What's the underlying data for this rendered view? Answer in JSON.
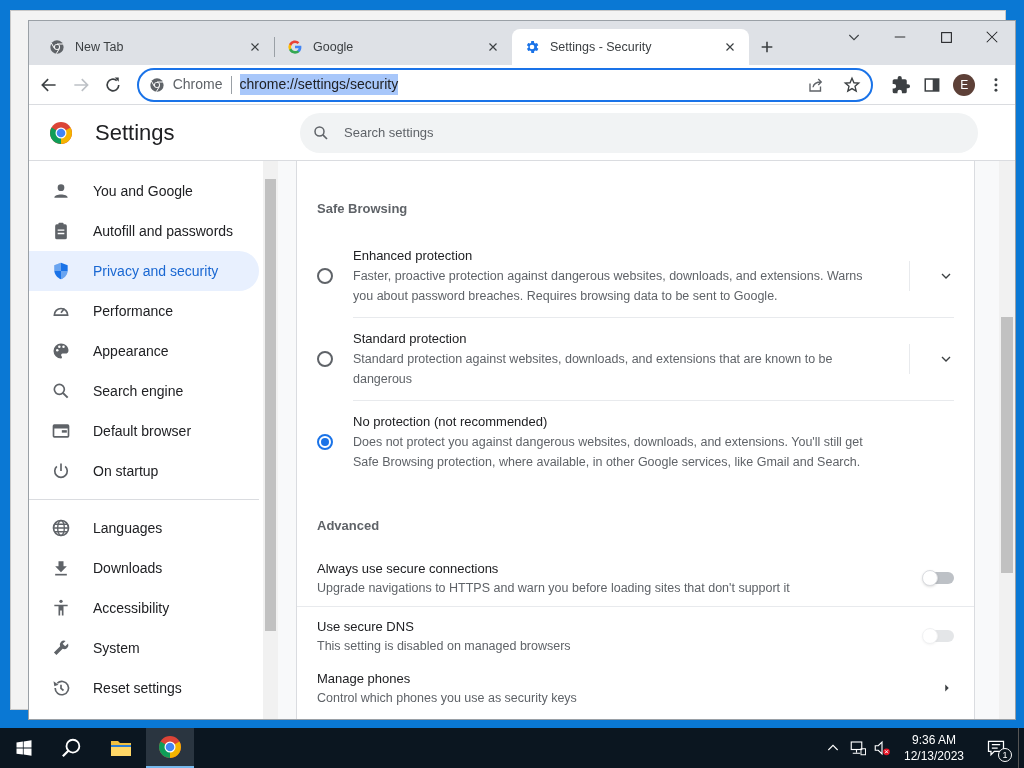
{
  "tabs": [
    {
      "title": "New Tab",
      "selected": false
    },
    {
      "title": "Google",
      "selected": false
    },
    {
      "title": "Settings - Security",
      "selected": true
    }
  ],
  "address_bar": {
    "site_label": "Chrome",
    "url": "chrome://settings/security",
    "url_selected": true
  },
  "profile": {
    "initial": "E"
  },
  "header": {
    "title": "Settings",
    "search": {
      "placeholder": "Search settings"
    }
  },
  "sidebar": {
    "groups": [
      [
        {
          "label": "You and Google",
          "selected": false
        },
        {
          "label": "Autofill and passwords",
          "selected": false
        },
        {
          "label": "Privacy and security",
          "selected": true
        },
        {
          "label": "Performance",
          "selected": false
        },
        {
          "label": "Appearance",
          "selected": false
        },
        {
          "label": "Search engine",
          "selected": false
        },
        {
          "label": "Default browser",
          "selected": false
        },
        {
          "label": "On startup",
          "selected": false
        }
      ],
      [
        {
          "label": "Languages",
          "selected": false
        },
        {
          "label": "Downloads",
          "selected": false
        },
        {
          "label": "Accessibility",
          "selected": false
        },
        {
          "label": "System",
          "selected": false
        },
        {
          "label": "Reset settings",
          "selected": false
        }
      ]
    ]
  },
  "safe_browsing": {
    "heading": "Safe Browsing",
    "options": [
      {
        "title": "Enhanced protection",
        "description": "Faster, proactive protection against dangerous websites, downloads, and extensions. Warns you about password breaches. Requires browsing data to be sent to Google.",
        "selected": false,
        "expandable": true
      },
      {
        "title": "Standard protection",
        "description": "Standard protection against websites, downloads, and extensions that are known to be dangerous",
        "selected": false,
        "expandable": true
      },
      {
        "title": "No protection (not recommended)",
        "description": "Does not protect you against dangerous websites, downloads, and extensions. You'll still get Safe Browsing protection, where available, in other Google services, like Gmail and Search.",
        "selected": true,
        "expandable": false
      }
    ]
  },
  "advanced": {
    "heading": "Advanced",
    "rows": [
      {
        "kind": "toggle",
        "title": "Always use secure connections",
        "description": "Upgrade navigations to HTTPS and warn you before loading sites that don't support it",
        "on": false,
        "disabled": false
      },
      {
        "kind": "toggle",
        "title": "Use secure DNS",
        "description": "This setting is disabled on managed browsers",
        "on": false,
        "disabled": true
      },
      {
        "kind": "link",
        "title": "Manage phones",
        "description": "Control which phones you use as security keys"
      }
    ]
  },
  "taskbar": {
    "time": "9:36 AM",
    "date": "12/13/2023",
    "notification_count": "1"
  }
}
